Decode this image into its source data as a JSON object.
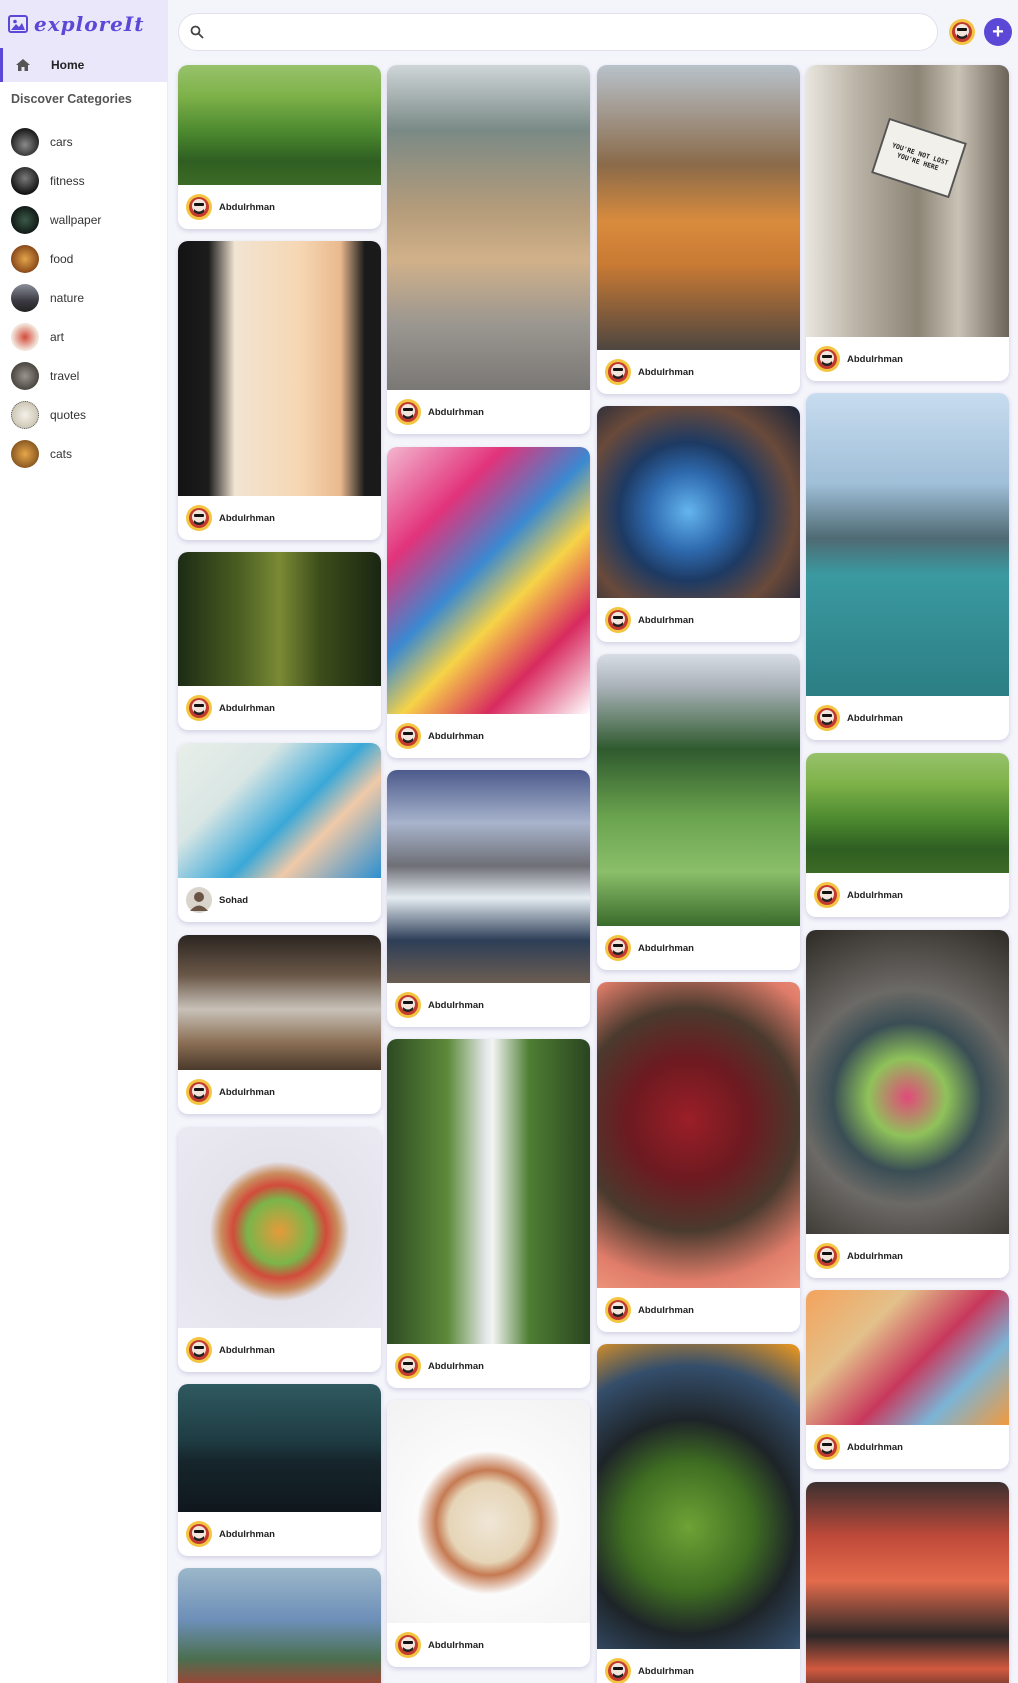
{
  "app": {
    "title": "exploreIt"
  },
  "sidebar": {
    "home_label": "Home",
    "categories_title": "Discover Categories",
    "categories": [
      {
        "label": "cars",
        "color": "#3a3a3a"
      },
      {
        "label": "fitness",
        "color": "#2c2c2c"
      },
      {
        "label": "wallpaper",
        "color": "#1e3028"
      },
      {
        "label": "food",
        "color": "#b4702e"
      },
      {
        "label": "nature",
        "color": "#5a5a66"
      },
      {
        "label": "art",
        "color": "#d24b3b"
      },
      {
        "label": "travel",
        "color": "#6a6660"
      },
      {
        "label": "quotes",
        "color": "#e8e4d8"
      },
      {
        "label": "cats",
        "color": "#c98a3d"
      }
    ]
  },
  "header": {
    "search_placeholder": "",
    "add_label": "+"
  },
  "feed": {
    "columns": [
      [
        {
          "author": "Abdulrhman",
          "image": "green-hills",
          "art": "g-hills"
        },
        {
          "author": "Abdulrhman",
          "image": "airport-traveler",
          "art": "g-airport"
        },
        {
          "author": "Abdulrhman",
          "image": "forest-path",
          "art": "g-forest"
        },
        {
          "author": "Sohad",
          "image": "dentist",
          "art": "g-dentist"
        },
        {
          "author": "Abdulrhman",
          "image": "dinner-table",
          "art": "g-dinner"
        },
        {
          "author": "Abdulrhman",
          "image": "salad-bowl",
          "art": "g-bowl"
        },
        {
          "author": "Abdulrhman",
          "image": "mountain-dusk",
          "art": "g-mountain"
        },
        {
          "author": "",
          "image": "wildflowers",
          "art": "g-flowers"
        }
      ],
      [
        {
          "author": "Abdulrhman",
          "image": "puppy-with-flower",
          "art": "g-dog"
        },
        {
          "author": "Abdulrhman",
          "image": "painted-face",
          "art": "g-face"
        },
        {
          "author": "Abdulrhman",
          "image": "highland-falls",
          "art": "g-falls"
        },
        {
          "author": "Abdulrhman",
          "image": "multnomah-falls",
          "art": "g-waterfall"
        },
        {
          "author": "Abdulrhman",
          "image": "clam-chowder",
          "art": "g-soup"
        }
      ],
      [
        {
          "author": "Abdulrhman",
          "image": "orange-cat",
          "art": "g-cat"
        },
        {
          "author": "Abdulrhman",
          "image": "bubble-nebula",
          "art": "g-nebula"
        },
        {
          "author": "Abdulrhman",
          "image": "mountain-trail",
          "art": "g-trail"
        },
        {
          "author": "Abdulrhman",
          "image": "red-roses",
          "art": "g-roses"
        },
        {
          "author": "Abdulrhman",
          "image": "green-salad",
          "art": "g-salad"
        }
      ],
      [
        {
          "author": "Abdulrhman",
          "image": "youre-not-lost-sign",
          "art": "g-door",
          "sign_text": "YOU'RE NOT LOST YOU'RE HERE"
        },
        {
          "author": "Abdulrhman",
          "image": "mountain-lake",
          "art": "g-lake"
        },
        {
          "author": "Abdulrhman",
          "image": "green-hills",
          "art": "g-hills"
        },
        {
          "author": "Abdulrhman",
          "image": "festive-platter",
          "art": "g-platter"
        },
        {
          "author": "Abdulrhman",
          "image": "food-spread",
          "art": "g-table"
        },
        {
          "author": "",
          "image": "sunset-coast",
          "art": "g-sunset"
        }
      ]
    ]
  }
}
